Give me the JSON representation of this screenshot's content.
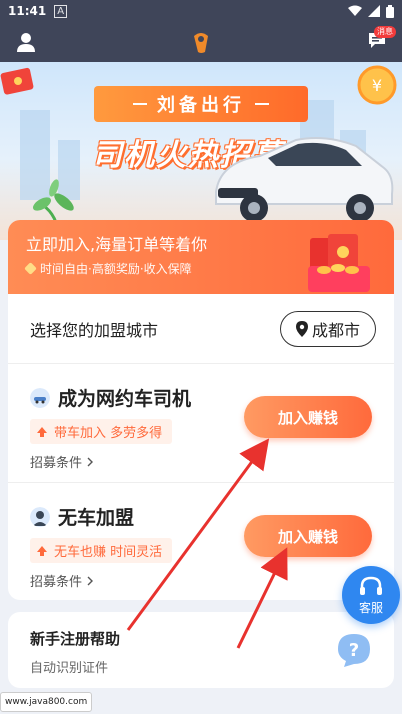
{
  "status_bar": {
    "time": "11:41",
    "a_icon": "A"
  },
  "app_bar": {
    "message_badge": "消息"
  },
  "banner": {
    "brand": "刘备出行",
    "headline": "司机火热招募中"
  },
  "card": {
    "head_title": "立即加入,海量订单等着你",
    "head_sub": "时间自由·高额奖励·收入保障",
    "city_label": "选择您的加盟城市",
    "city_value": "成都市",
    "options": [
      {
        "title": "成为网约车司机",
        "tag": "带车加入 多劳多得",
        "cond": "招募条件",
        "button": "加入赚钱"
      },
      {
        "title": "无车加盟",
        "tag": "无车也赚 时间灵活",
        "cond": "招募条件",
        "button": "加入赚钱"
      }
    ]
  },
  "help": {
    "title": "新手注册帮助",
    "subtitle": "自动识别证件"
  },
  "service": {
    "label": "客服"
  },
  "watermark": "www.java800.com",
  "colors": {
    "accent": "#ff6a3c",
    "appbar": "#3f4559",
    "service": "#2f87f0"
  }
}
